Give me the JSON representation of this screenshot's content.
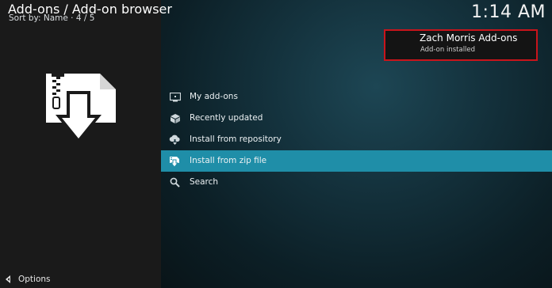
{
  "header": {
    "title": "Add-ons / Add-on browser",
    "sort_info": "Sort by: Name  ·  4 / 5"
  },
  "clock": "1:14 AM",
  "notification": {
    "title": "Zach Morris Add-ons",
    "message": "Add-on installed",
    "highlight_color": "#c9141b"
  },
  "menu": {
    "items": [
      {
        "label": "My add-ons",
        "icon": "monitor-icon"
      },
      {
        "label": "Recently updated",
        "icon": "box-icon"
      },
      {
        "label": "Install from repository",
        "icon": "cloud-download-icon"
      },
      {
        "label": "Install from zip file",
        "icon": "zip-install-icon",
        "focused": true
      },
      {
        "label": "Search",
        "icon": "search-icon"
      }
    ],
    "focus_color": "#1f8ea8"
  },
  "footer": {
    "options_label": "Options"
  }
}
